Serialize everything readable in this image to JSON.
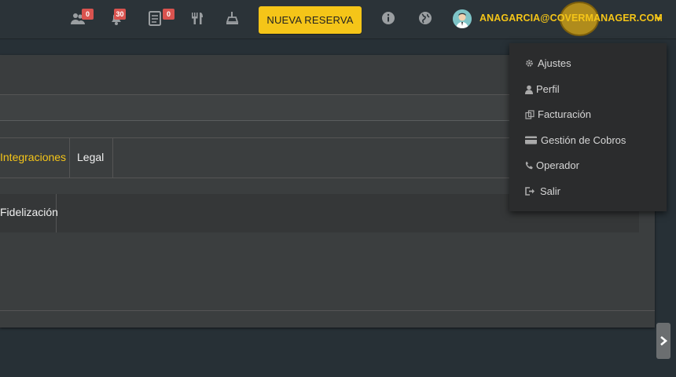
{
  "topbar": {
    "badges": {
      "groups": "0",
      "notifications": "30",
      "reservations_list": "0"
    },
    "new_reservation_label": "NUEVA RESERVA",
    "user_email": "ANAGARCIA@COVERMANAGER.COM",
    "accent_color": "#f5c518"
  },
  "panel": {
    "tabs": [
      {
        "label": "Integraciones",
        "active": true
      },
      {
        "label": "Legal",
        "active": false
      }
    ],
    "subtabs": [
      {
        "label": "Fidelización"
      }
    ]
  },
  "dropdown": {
    "items": [
      {
        "label": "Ajustes",
        "icon": "gear-icon"
      },
      {
        "label": "Perfil",
        "icon": "user-icon"
      },
      {
        "label": "Facturación",
        "icon": "copy-icon"
      },
      {
        "label": "Gestión de Cobros",
        "icon": "credit-card-icon"
      },
      {
        "label": "Operador",
        "icon": "phone-icon"
      },
      {
        "label": "Salir",
        "icon": "sign-out-icon"
      }
    ]
  }
}
